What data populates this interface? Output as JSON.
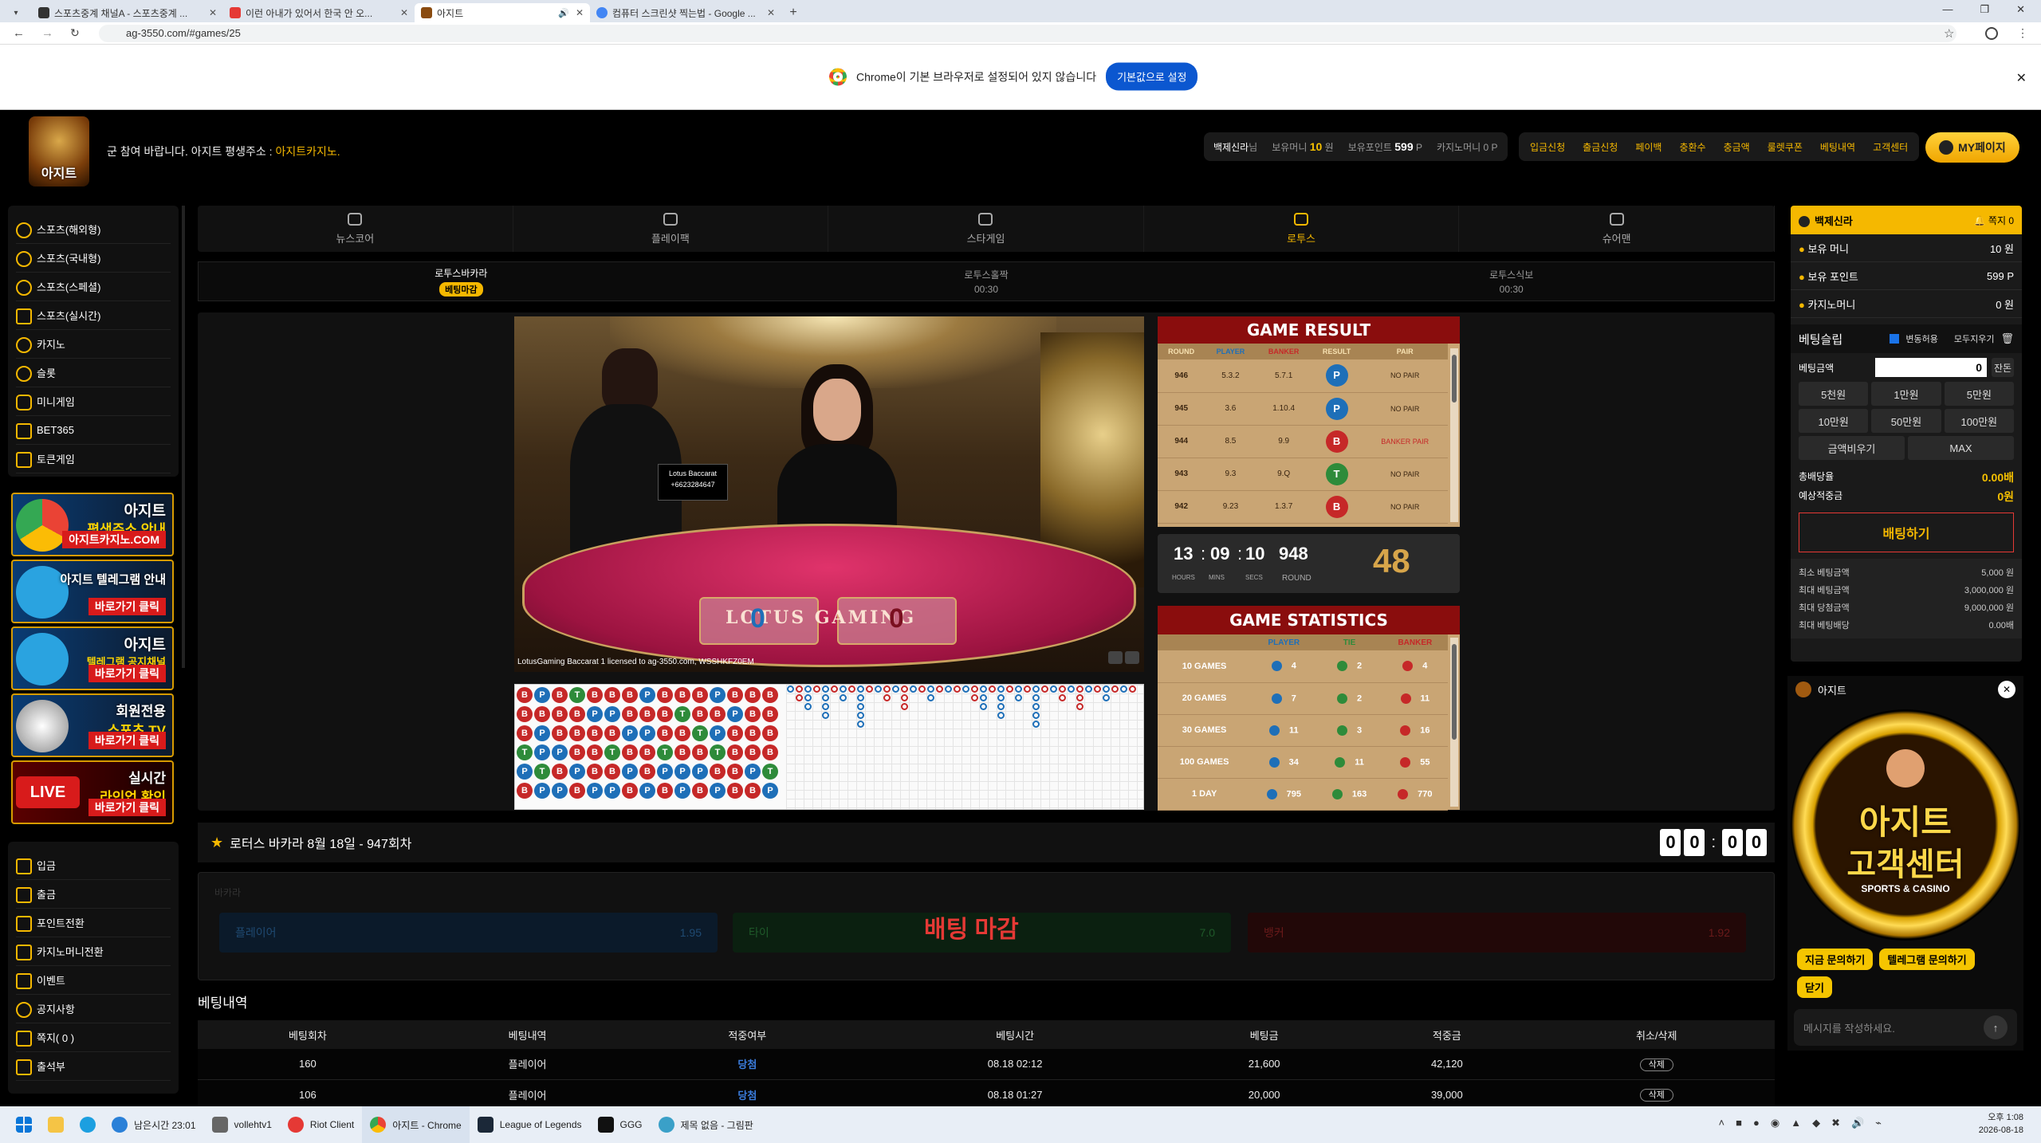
{
  "browser": {
    "tabs": [
      {
        "title": "스포츠중계 채널A - 스포츠중계 ..."
      },
      {
        "title": "이런 아내가 있어서 한국 안 오..."
      },
      {
        "title": "아지트",
        "active": true
      },
      {
        "title": "컴퓨터 스크린샷 찍는법 - Google ..."
      }
    ],
    "url": "ag-3550.com/#games/25",
    "infobar_text": "Chrome이 기본 브라우저로 설정되어 있지 않습니다",
    "infobar_button": "기본값으로 설정"
  },
  "header": {
    "logo_text": "아지트",
    "ticker_prefix": "군 참여 바랍니다. 아지트 평생주소 : ",
    "ticker_link": "아지트카지노.",
    "user_name": "백제신라",
    "user_suffix": "님",
    "money_label": "보유머니",
    "money_value": "10",
    "money_unit": "원",
    "point_label": "보유포인트",
    "point_value": "599",
    "point_unit": "P",
    "casino_label": "카지노머니",
    "casino_value": "0 P",
    "menu": [
      "입금신청",
      "출금신청",
      "페이백",
      "충환수",
      "충금액",
      "룰렛쿠폰",
      "베팅내역",
      "고객센터"
    ],
    "mypage": "MY페이지"
  },
  "sidebar": {
    "items": [
      "스포츠(해외형)",
      "스포츠(국내형)",
      "스포츠(스페셜)",
      "스포츠(실시간)",
      "카지노",
      "슬롯",
      "미니게임",
      "BET365",
      "토큰게임"
    ],
    "banners": [
      {
        "title": "아지트",
        "sub": "평생주소 안내",
        "tag": "아지트카지노.COM"
      },
      {
        "title": "아지트 텔레그램 안내",
        "sub": "",
        "tag": "바로가기 클릭"
      },
      {
        "title": "아지트",
        "sub": "텔레그램 공지채널",
        "tag": "바로가기 클릭"
      },
      {
        "title": "회원전용",
        "sub": "스포츠 TV",
        "tag": "바로가기 클릭"
      },
      {
        "title": "실시간",
        "sub": "라인업 확인",
        "tag": "바로가기 클릭"
      }
    ],
    "items2": [
      "입금",
      "출금",
      "포인트전환",
      "카지노머니전환",
      "이벤트",
      "공지사항",
      "쪽지( 0 )",
      "출석부"
    ]
  },
  "game_tabs": [
    "뉴스코어",
    "플레이팩",
    "스타게임",
    "로투스",
    "슈어맨"
  ],
  "sub_tabs": [
    {
      "name": "로투스바카라",
      "time": "베팅마감"
    },
    {
      "name": "로투스홀짝",
      "time": "00:30"
    },
    {
      "name": "로투스식보",
      "time": "00:30"
    }
  ],
  "video": {
    "sign_title": "Lotus Baccarat",
    "sign_phone": "+6623284647",
    "license_text": "LotusGaming Baccarat 1 licensed to ag-3550.com, WSSHKFZ0EM",
    "score_left": "0",
    "score_right": "0",
    "brand": "LOTUS GAMING"
  },
  "game_result": {
    "title": "GAME RESULT",
    "headers": [
      "ROUND",
      "PLAYER",
      "BANKER",
      "RESULT",
      "PAIR"
    ],
    "rows": [
      {
        "round": "946",
        "player": "5.3.2",
        "banker": "5.7.1",
        "result": "P",
        "pair": "NO PAIR"
      },
      {
        "round": "945",
        "player": "3.6",
        "banker": "1.10.4",
        "result": "P",
        "pair": "NO PAIR"
      },
      {
        "round": "944",
        "player": "8.5",
        "banker": "9.9",
        "result": "B",
        "pair": "BANKER PAIR"
      },
      {
        "round": "943",
        "player": "9.3",
        "banker": "9.Q",
        "result": "T",
        "pair": "NO PAIR"
      },
      {
        "round": "942",
        "player": "9.23",
        "banker": "1.3.7",
        "result": "B",
        "pair": "NO PAIR"
      }
    ]
  },
  "timer": {
    "hours": "13",
    "mins": "09",
    "secs": "10",
    "round": "948",
    "countdown": "48",
    "l_hours": "HOURS",
    "l_mins": "MINS",
    "l_secs": "SECS",
    "l_round": "ROUND"
  },
  "game_statistics": {
    "title": "GAME STATISTICS",
    "headers": [
      "",
      "PLAYER",
      "TIE",
      "BANKER"
    ],
    "rows": [
      {
        "label": "10 GAMES",
        "player": "4",
        "tie": "2",
        "banker": "4"
      },
      {
        "label": "20 GAMES",
        "player": "7",
        "tie": "2",
        "banker": "11"
      },
      {
        "label": "30 GAMES",
        "player": "11",
        "tie": "3",
        "banker": "16"
      },
      {
        "label": "100 GAMES",
        "player": "34",
        "tie": "11",
        "banker": "55"
      },
      {
        "label": "1 DAY",
        "player": "795",
        "tie": "163",
        "banker": "770"
      }
    ]
  },
  "round_title": "로터스 바카라 8월 18일 - 947회차",
  "round_digits": [
    "0",
    "0",
    "0",
    "0"
  ],
  "bet": {
    "section_label": "바카라",
    "closed_text": "배팅 마감",
    "options": [
      {
        "name": "플레이어",
        "odds": "1.95"
      },
      {
        "name": "타이",
        "odds": "7.0"
      },
      {
        "name": "뱅커",
        "odds": "1.92"
      }
    ]
  },
  "history": {
    "title": "베팅내역",
    "headers": [
      "베팅회차",
      "베팅내역",
      "적중여부",
      "베팅시간",
      "베팅금",
      "적중금",
      "취소/삭제"
    ],
    "rows": [
      {
        "round": "160",
        "pick": "플레이어",
        "result": "당첨",
        "time": "08.18 02:12",
        "amount": "21,600",
        "win": "42,120",
        "action": "삭제"
      },
      {
        "round": "106",
        "pick": "플레이어",
        "result": "당첨",
        "time": "08.18 01:27",
        "amount": "20,000",
        "win": "39,000",
        "action": "삭제"
      }
    ]
  },
  "right_panel": {
    "user": "백제신라",
    "note": "쪽지 0",
    "rows": [
      {
        "label": "보유 머니",
        "value": "10 원"
      },
      {
        "label": "보유 포인트",
        "value": "599 P"
      },
      {
        "label": "카지노머니",
        "value": "0 원"
      }
    ],
    "slip_title": "베팅슬립",
    "fix_label": "변동허용",
    "clear_label": "모두지우기",
    "amount_label": "베팅금액",
    "amount_value": "0",
    "change_btn": "잔돈",
    "quick": [
      "5천원",
      "1만원",
      "5만원",
      "10만원",
      "50만원",
      "100만원",
      "금액비우기",
      "MAX"
    ],
    "total_odds_label": "총배당율",
    "total_odds": "0.00배",
    "expected_label": "예상적중금",
    "expected": "0원",
    "bet_button": "배팅하기",
    "limits": [
      {
        "label": "최소 베팅금액",
        "value": "5,000 원"
      },
      {
        "label": "최대 베팅금액",
        "value": "3,000,000 원"
      },
      {
        "label": "최대 당첨금액",
        "value": "9,000,000 원"
      },
      {
        "label": "최대 베팅배당",
        "value": "0.00배"
      }
    ]
  },
  "chat": {
    "title": "아지트",
    "logo_big": "아지트",
    "logo_sub": "고객센터",
    "logo_tag": "SPORTS & CASINO",
    "buttons": [
      "지금 문의하기",
      "텔레그램 문의하기",
      "닫기"
    ],
    "placeholder": "메시지를 작성하세요."
  },
  "taskbar": {
    "items": [
      "남은시간 23:01",
      "vollehtv1",
      "Riot Client",
      "아지트 - Chrome",
      "League of Legends",
      "GGG",
      "제목 없음 - 그림판"
    ],
    "time": "오후 1:08",
    "date": "2026-08-18"
  },
  "colors": {
    "gold": "#f5b800",
    "player": "#1e6fb8",
    "banker": "#c62828",
    "tie": "#2e8b3a"
  }
}
